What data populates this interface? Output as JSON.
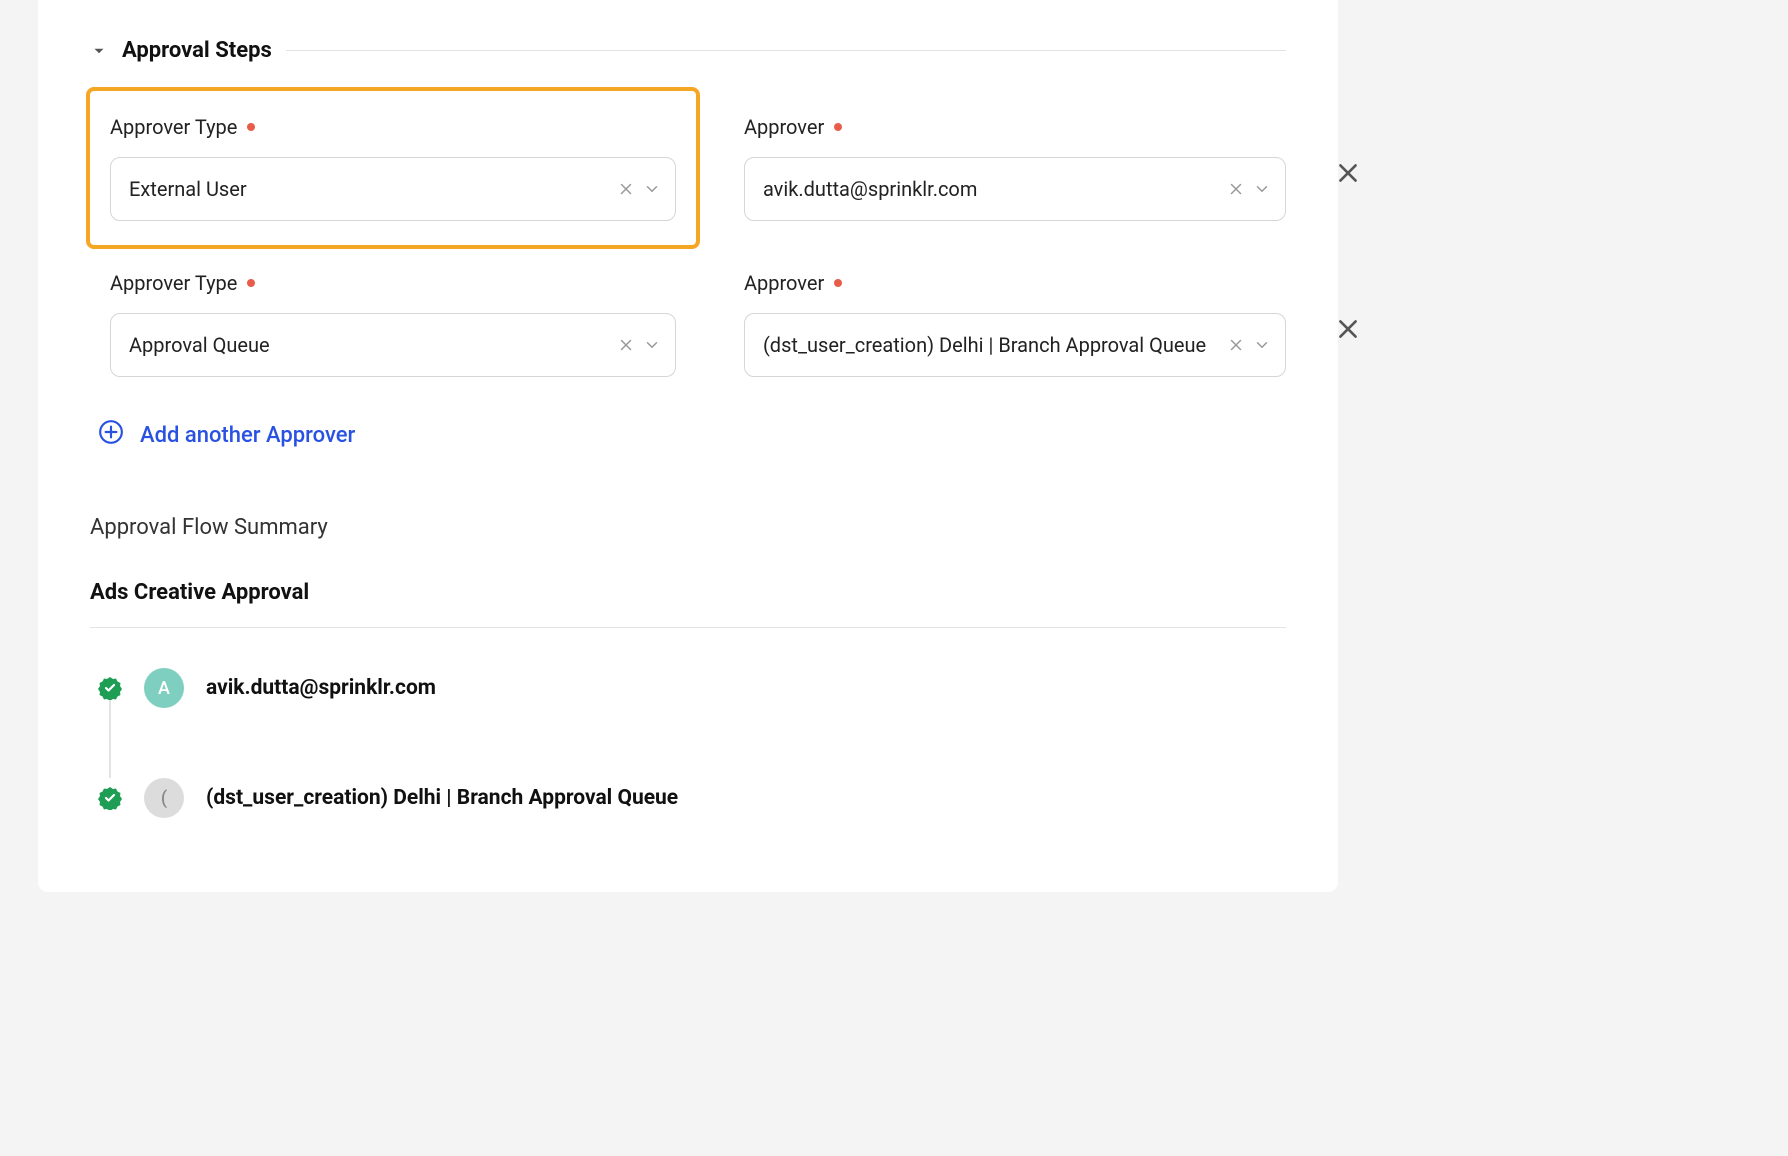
{
  "section": {
    "title": "Approval Steps"
  },
  "rows": [
    {
      "typeLabel": "Approver Type",
      "typeValue": "External User",
      "approverLabel": "Approver",
      "approverValue": "avik.dutta@sprinklr.com",
      "highlighted": true
    },
    {
      "typeLabel": "Approver Type",
      "typeValue": "Approval Queue",
      "approverLabel": "Approver",
      "approverValue": "(dst_user_creation) Delhi | Branch Approval Queue",
      "highlighted": false
    }
  ],
  "addLink": {
    "label": "Add another Approver"
  },
  "summary": {
    "heading": "Approval Flow Summary",
    "sub": "Ads Creative Approval",
    "items": [
      {
        "avatarLetter": "A",
        "avatarClass": "teal",
        "label": "avik.dutta@sprinklr.com"
      },
      {
        "avatarLetter": "(",
        "avatarClass": "grey",
        "label": "(dst_user_creation) Delhi | Branch Approval Queue"
      }
    ]
  }
}
